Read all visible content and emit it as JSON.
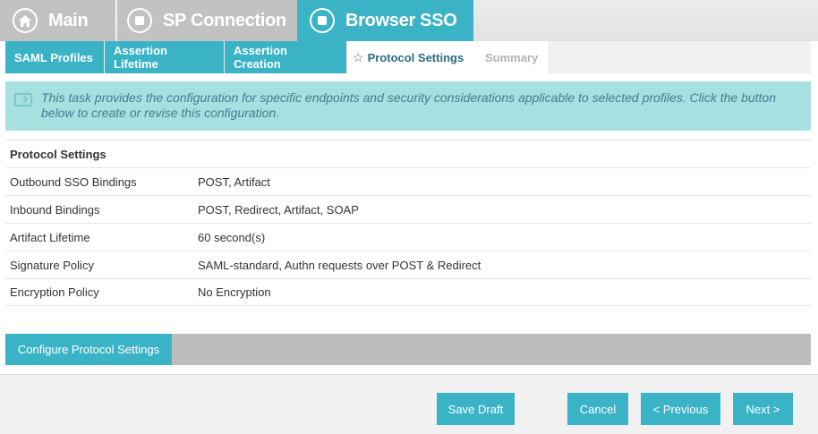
{
  "top_tabs": {
    "main": "Main",
    "sp_connection": "SP Connection",
    "browser_sso": "Browser SSO"
  },
  "sub_tabs": {
    "saml_profiles": "SAML Profiles",
    "assertion_lifetime": "Assertion Lifetime",
    "assertion_creation": "Assertion Creation",
    "protocol_settings": "Protocol Settings",
    "summary": "Summary"
  },
  "info": {
    "text": "This task provides the configuration for specific endpoints and security considerations applicable to selected profiles. Click the button below to create or revise this configuration."
  },
  "table": {
    "header": "Protocol Settings",
    "rows": [
      {
        "key": "Outbound SSO Bindings",
        "value": "POST, Artifact"
      },
      {
        "key": "Inbound Bindings",
        "value": "POST, Redirect, Artifact, SOAP"
      },
      {
        "key": "Artifact Lifetime",
        "value": "60 second(s)"
      },
      {
        "key": "Signature Policy",
        "value": "SAML-standard, Authn requests over POST & Redirect"
      },
      {
        "key": "Encryption Policy",
        "value": "No Encryption"
      }
    ]
  },
  "configure_button": "Configure Protocol Settings",
  "footer": {
    "save_draft": "Save Draft",
    "cancel": "Cancel",
    "previous": "< Previous",
    "next": "Next >"
  },
  "colors": {
    "accent": "#3ab3c6",
    "inactive_tab": "#c2c2c2",
    "info_bg": "#a7e0e0"
  }
}
